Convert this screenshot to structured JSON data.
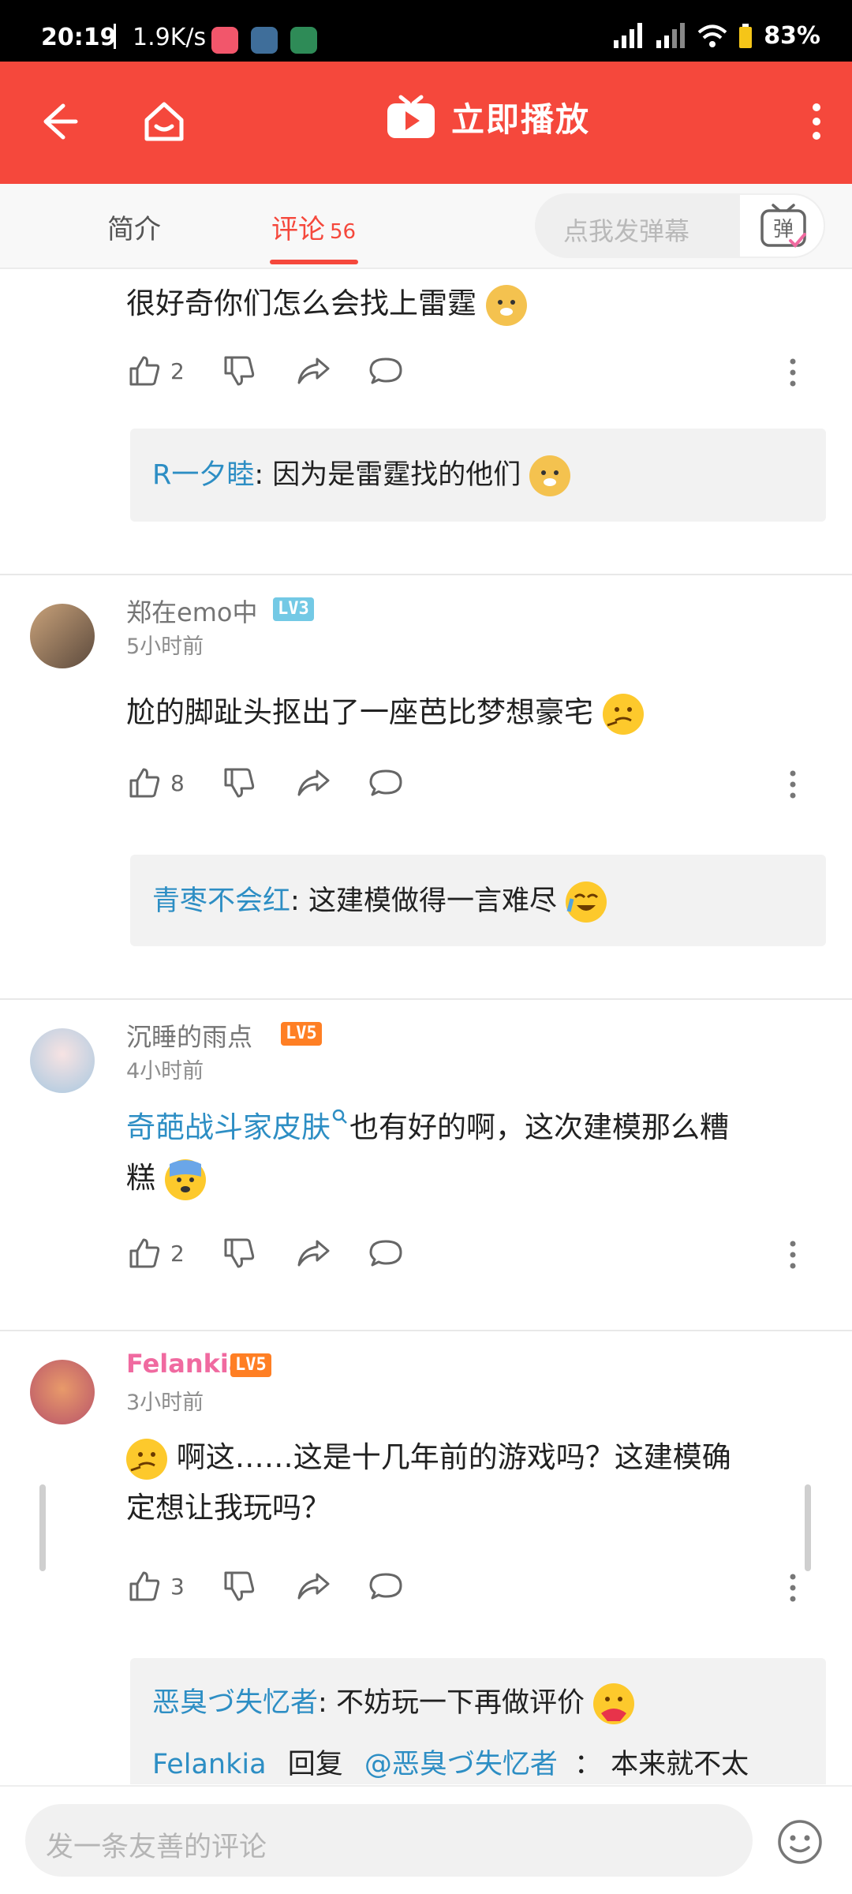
{
  "status_bar": {
    "time": "20:19",
    "speed": "1.9K/s",
    "battery": "83%"
  },
  "header": {
    "play_label": "立即播放"
  },
  "tabs": {
    "intro_label": "简介",
    "comments_label": "评论",
    "comments_count": "56",
    "danmaku_placeholder": "点我发弹幕",
    "danmaku_button": "弹"
  },
  "comments": [
    {
      "text": "很好奇你们怎么会找上雷霆",
      "likes": "2",
      "reply": {
        "name": "R一夕睦",
        "sep": ": ",
        "text": "因为是雷霆找的他们"
      }
    },
    {
      "username": "郑在emo中",
      "level": "LV3",
      "time": "5小时前",
      "text": "尬的脚趾头抠出了一座芭比梦想豪宅",
      "likes": "8",
      "reply": {
        "name": "青枣不会红",
        "sep": ": ",
        "text": "这建模做得一言难尽"
      }
    },
    {
      "username": "沉睡的雨点",
      "level": "LV5",
      "time": "4小时前",
      "link_text": "奇葩战斗家皮肤",
      "text_line1": "也有好的啊，这次建模那么糟",
      "text_line2": "糕",
      "likes": "2"
    },
    {
      "username": "Felankia",
      "level": "LV5",
      "time": "3小时前",
      "text_line1": "啊这……这是十几年前的游戏吗？这建模确",
      "text_line2": "定想让我玩吗？",
      "likes": "3",
      "reply": {
        "name": "恶臭づ失忆者",
        "sep": ": ",
        "text": "不妨玩一下再做评价"
      },
      "reply2": {
        "name": "Felankia",
        "verb": "回复",
        "mention": "@恶臭づ失忆者",
        "sep": "：",
        "text": "本来就不太"
      }
    }
  ],
  "bottom": {
    "placeholder": "发一条友善的评论"
  },
  "colors": {
    "brand": "#f5483c",
    "link": "#2d8ec4",
    "felankia_name": "#f06aa0"
  }
}
